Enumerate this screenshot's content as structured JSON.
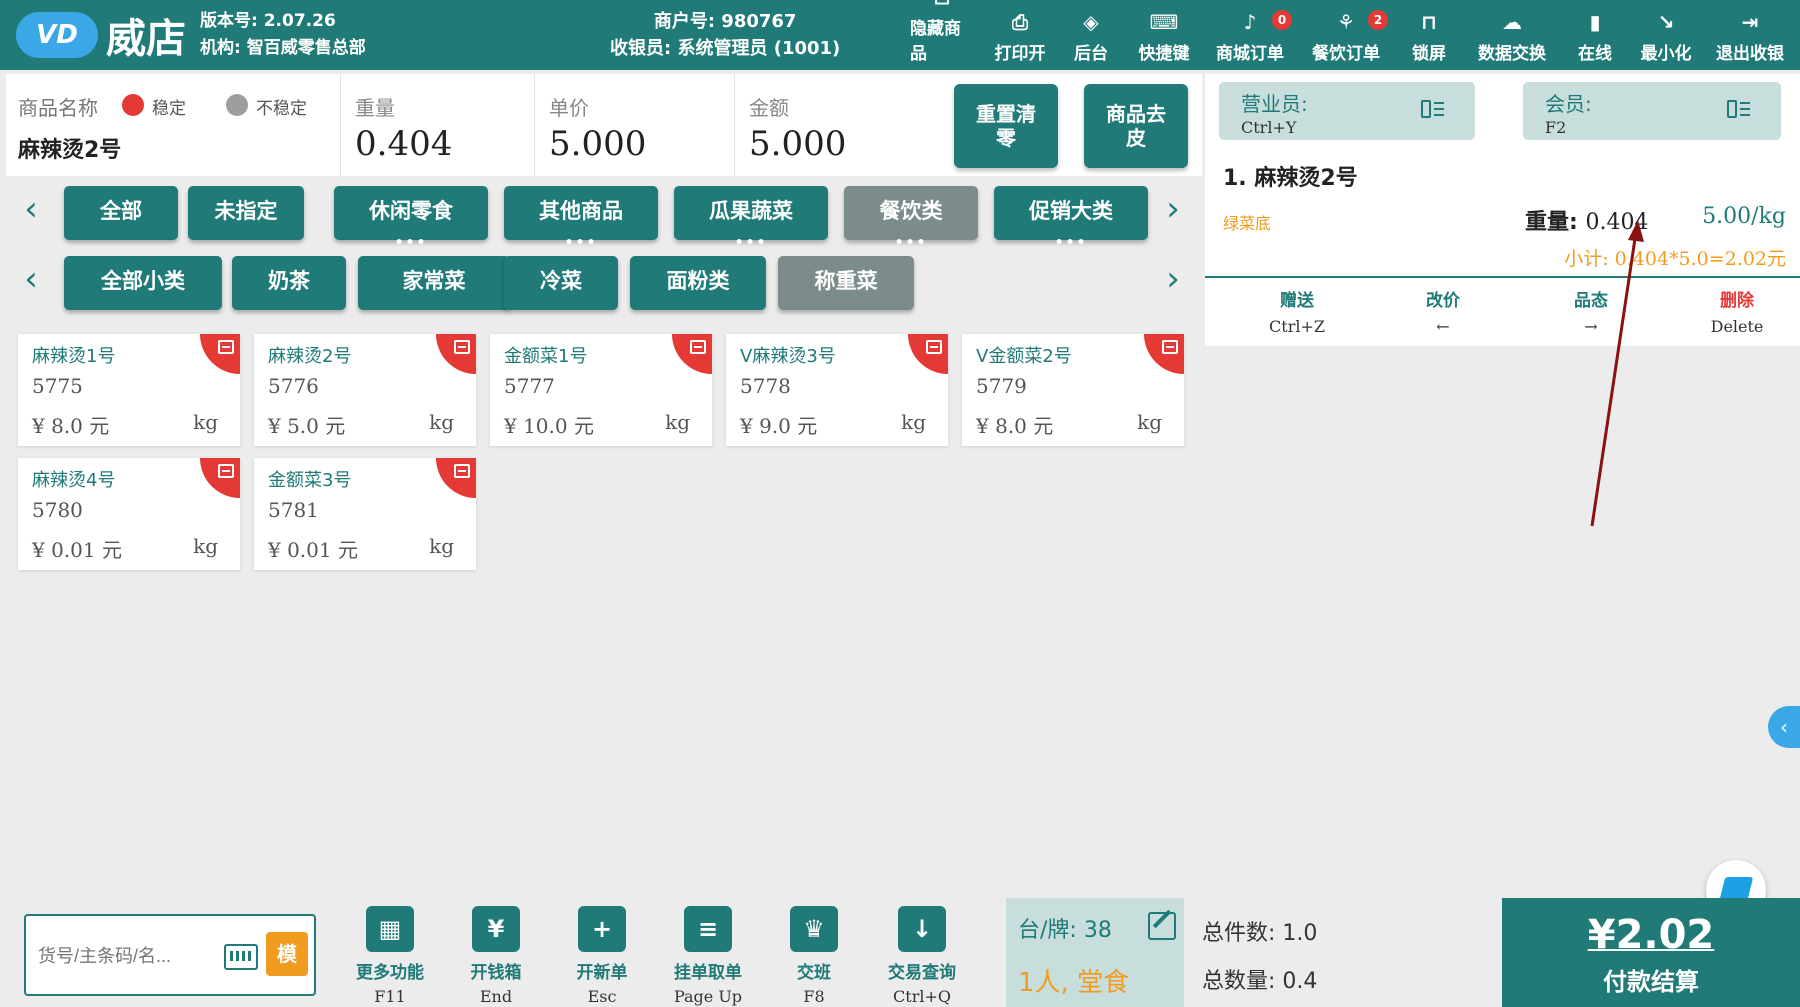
{
  "header": {
    "logo_badge": "VD",
    "logo_text": "威店",
    "version": "版本号: 2.07.26",
    "org": "机构: 智百威零售总部",
    "merchant": "商户号: 980767",
    "cashier": "收银员: 系统管理员 (1001)"
  },
  "toolbar": [
    {
      "icon": "hide-icon",
      "glyph": "⊡",
      "label": "隐藏商品"
    },
    {
      "icon": "printer-icon",
      "glyph": "⎙",
      "label": "打印开"
    },
    {
      "icon": "layers-icon",
      "glyph": "◈",
      "label": "后台"
    },
    {
      "icon": "keyboard-icon",
      "glyph": "⌨",
      "label": "快捷键"
    },
    {
      "icon": "mall-order-icon",
      "glyph": "♪",
      "label": "商城订单",
      "badge": "0"
    },
    {
      "icon": "restaurant-icon",
      "glyph": "⚘",
      "label": "餐饮订单",
      "badge": "2"
    },
    {
      "icon": "lock-icon",
      "glyph": "⊓",
      "label": "锁屏"
    },
    {
      "icon": "cloud-sync-icon",
      "glyph": "☁",
      "label": "数据交换"
    },
    {
      "icon": "signal-icon",
      "glyph": "▮",
      "label": "在线"
    },
    {
      "icon": "minimize-icon",
      "glyph": "↘",
      "label": "最小化"
    },
    {
      "icon": "exit-icon",
      "glyph": "⇥",
      "label": "退出收银"
    }
  ],
  "product_info": {
    "name_label": "商品名称",
    "stable": "稳定",
    "unstable": "不稳定",
    "name": "麻辣烫2号",
    "weight_label": "重量",
    "weight": "0.404",
    "unit_price_label": "单价",
    "unit_price": "5.000",
    "amount_label": "金额",
    "amount": "5.000",
    "reset_button": "重置清零",
    "tare_button": "商品去皮"
  },
  "categories_top": [
    {
      "label": "全部",
      "more": false,
      "grey": false
    },
    {
      "label": "未指定",
      "more": false,
      "grey": false
    },
    {
      "label": "休闲零食",
      "more": true,
      "grey": false
    },
    {
      "label": "其他商品",
      "more": true,
      "grey": false
    },
    {
      "label": "瓜果蔬菜",
      "more": true,
      "grey": false
    },
    {
      "label": "餐饮类",
      "more": true,
      "grey": true
    },
    {
      "label": "促销大类",
      "more": true,
      "grey": false
    }
  ],
  "categories_sub": [
    {
      "label": "全部小类",
      "grey": false
    },
    {
      "label": "奶茶",
      "grey": false
    },
    {
      "label": "家常菜",
      "grey": false
    },
    {
      "label": "冷菜",
      "grey": false
    },
    {
      "label": "面粉类",
      "grey": false
    },
    {
      "label": "称重菜",
      "grey": true
    }
  ],
  "products": [
    {
      "name": "麻辣烫1号",
      "code": "5775",
      "price": "¥ 8.0 元",
      "unit": "kg"
    },
    {
      "name": "麻辣烫2号",
      "code": "5776",
      "price": "¥ 5.0 元",
      "unit": "kg"
    },
    {
      "name": "金额菜1号",
      "code": "5777",
      "price": "¥ 10.0 元",
      "unit": "kg"
    },
    {
      "name": "V麻辣烫3号",
      "code": "5778",
      "price": "¥ 9.0 元",
      "unit": "kg"
    },
    {
      "name": "V金额菜2号",
      "code": "5779",
      "price": "¥ 8.0 元",
      "unit": "kg"
    },
    {
      "name": "麻辣烫4号",
      "code": "5780",
      "price": "¥ 0.01 元",
      "unit": "kg"
    },
    {
      "name": "金额菜3号",
      "code": "5781",
      "price": "¥ 0.01 元",
      "unit": "kg"
    }
  ],
  "right_panel": {
    "salesperson_label": "营业员:",
    "salesperson_shortcut": "Ctrl+Y",
    "member_label": "会员:",
    "member_shortcut": "F2",
    "order_title": "1. 麻辣烫2号",
    "order_tag": "绿菜底",
    "weight_label": "重量: ",
    "weight_value": "0.404",
    "unit_price": "5.00/kg",
    "subtotal": "小计: 0.404*5.0=2.02元",
    "actions": [
      {
        "label": "赠送",
        "key": "Ctrl+Z"
      },
      {
        "label": "改价",
        "key": "←"
      },
      {
        "label": "品态",
        "key": "→"
      },
      {
        "label": "删除",
        "key": "Delete"
      }
    ]
  },
  "bottom": {
    "search_placeholder": "货号/主条码/名...",
    "mode_button": "模",
    "functions": [
      {
        "icon": "grid-icon",
        "glyph": "▦",
        "label": "更多功能",
        "key": "F11"
      },
      {
        "icon": "cash-drawer-icon",
        "glyph": "¥",
        "label": "开钱箱",
        "key": "End"
      },
      {
        "icon": "new-order-icon",
        "glyph": "+",
        "label": "开新单",
        "key": "Esc"
      },
      {
        "icon": "hold-order-icon",
        "glyph": "≡",
        "label": "挂单取单",
        "key": "Page Up"
      },
      {
        "icon": "crown-icon",
        "glyph": "♛",
        "label": "交班",
        "key": "F8"
      },
      {
        "icon": "query-icon",
        "glyph": "↓",
        "label": "交易查询",
        "key": "Ctrl+Q"
      }
    ],
    "table_label": "台/牌: 38",
    "dine_mode": "1人, 堂食",
    "total_items": "总件数: 1.0",
    "total_qty": "总数量: 0.4",
    "pay_amount": "¥2.02",
    "pay_label": "付款结算"
  },
  "colors": {
    "primary": "#1f7a78",
    "accent_orange": "#f29c1f",
    "alert_red": "#e53935",
    "annotation_arrow": "#8b1010"
  }
}
